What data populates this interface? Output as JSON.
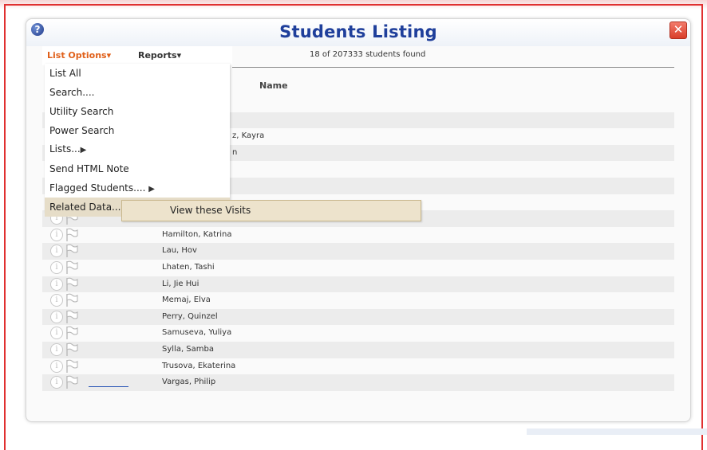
{
  "dialog": {
    "title": "Students Listing",
    "help_icon": "question-icon",
    "close_icon": "close-icon",
    "close_symbol": "✕"
  },
  "menubar": {
    "list_options_label": "List Options",
    "reports_label": "Reports",
    "caret": "▾"
  },
  "status": {
    "count_text": "18 of 207333 students found"
  },
  "table": {
    "columns": [
      "Name"
    ],
    "rows": [
      {
        "name": "",
        "visible_fragment": ""
      },
      {
        "name": "",
        "visible_fragment": ""
      },
      {
        "name": "",
        "visible_fragment": "z, Kayra"
      },
      {
        "name": "",
        "visible_fragment": "n"
      },
      {
        "name": "",
        "visible_fragment": ""
      },
      {
        "name": "",
        "visible_fragment": ""
      },
      {
        "name": "",
        "visible_fragment": ""
      },
      {
        "name": "",
        "visible_fragment": ""
      },
      {
        "name": "Hamilton, Katrina"
      },
      {
        "name": "Lau, Hov"
      },
      {
        "name": "Lhaten, Tashi"
      },
      {
        "name": "Li, Jie Hui"
      },
      {
        "name": "Memaj, Elva"
      },
      {
        "name": "Perry, Quinzel"
      },
      {
        "name": "Samuseva, Yuliya"
      },
      {
        "name": "Sylla, Samba"
      },
      {
        "name": "Trusova, Ekaterina"
      },
      {
        "name": "Vargas, Philip"
      }
    ]
  },
  "dropdown": {
    "items": [
      {
        "label": "List All"
      },
      {
        "label": "Search...."
      },
      {
        "label": "Utility Search"
      },
      {
        "label": "Power Search"
      },
      {
        "label": "Lists...",
        "submenu": true
      },
      {
        "label": "Send HTML Note"
      },
      {
        "label": "Flagged Students....",
        "submenu": true
      },
      {
        "label": "Related Data....",
        "submenu": true,
        "hover": true
      }
    ],
    "arrow": "▶"
  },
  "submenu": {
    "items": [
      {
        "label": "View these Visits"
      }
    ]
  }
}
